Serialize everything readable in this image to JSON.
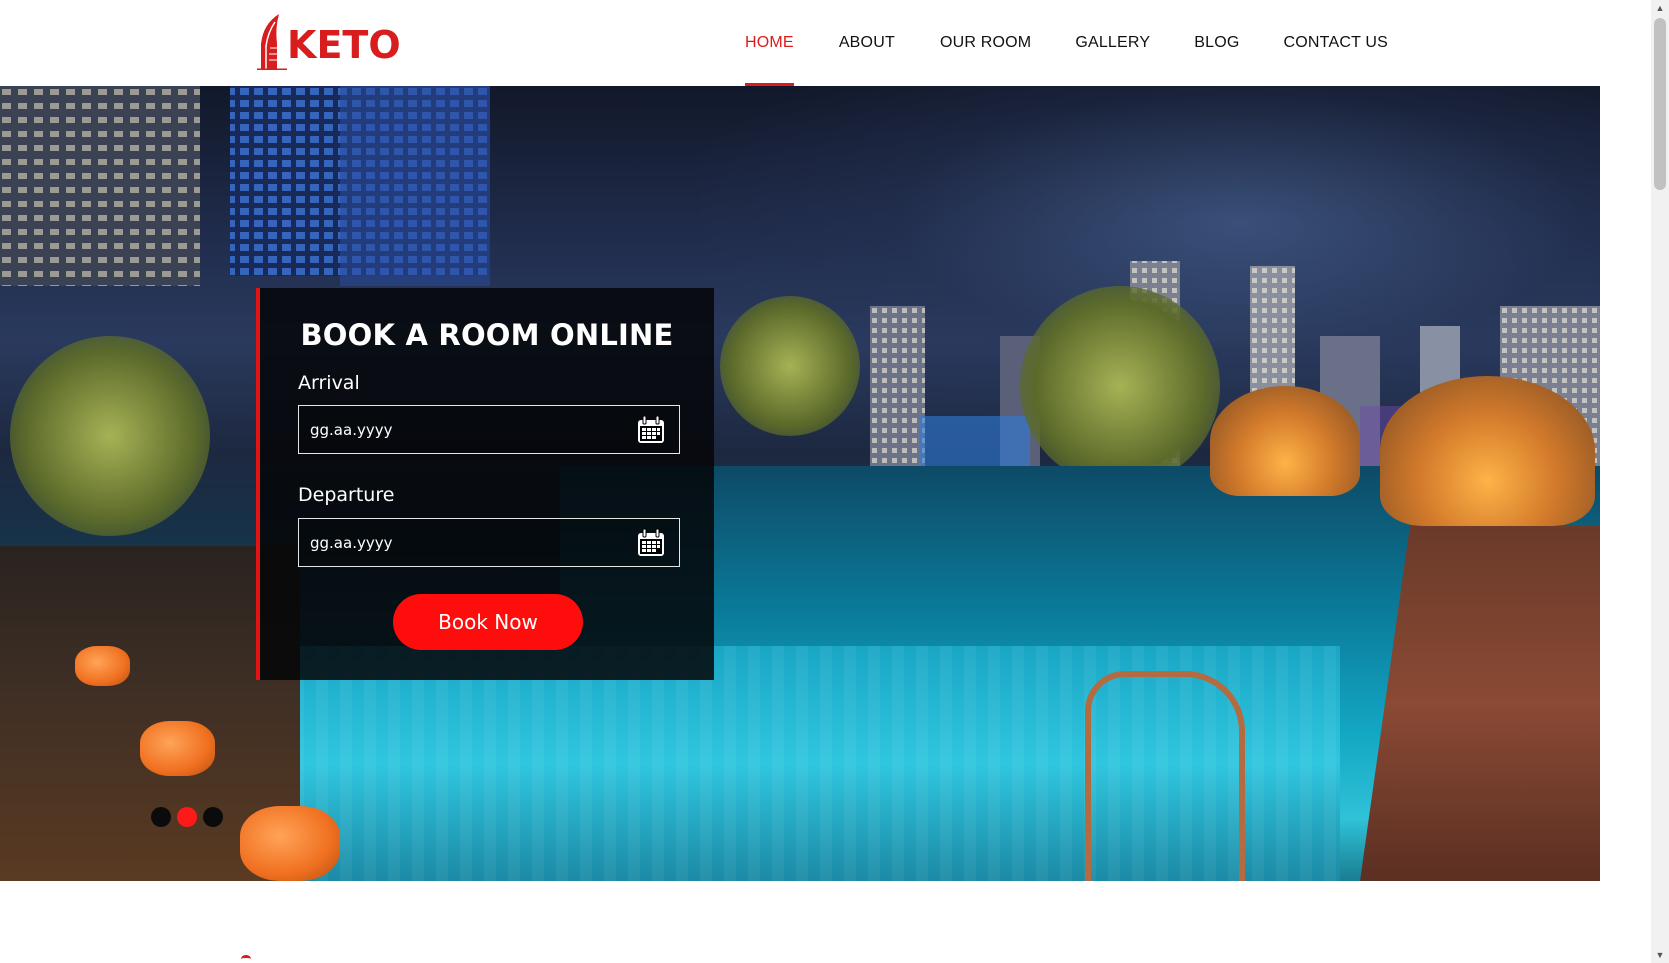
{
  "brand": {
    "name": "KETO",
    "logo_icon": "hotel-tower-icon",
    "color": "#d71d1d"
  },
  "nav": {
    "items": [
      {
        "label": "HOME",
        "active": true
      },
      {
        "label": "ABOUT",
        "active": false
      },
      {
        "label": "OUR ROOM",
        "active": false
      },
      {
        "label": "GALLERY",
        "active": false
      },
      {
        "label": "BLOG",
        "active": false
      },
      {
        "label": "CONTACT US",
        "active": false
      }
    ],
    "active_color": "#d91c1c"
  },
  "booking": {
    "title": "BOOK A ROOM ONLINE",
    "arrival": {
      "label": "Arrival",
      "placeholder": "gg.aa.yyyy",
      "icon": "calendar-icon"
    },
    "departure": {
      "label": "Departure",
      "placeholder": "gg.aa.yyyy",
      "icon": "calendar-icon"
    },
    "submit_label": "Book Now",
    "accent": "#ff0d0d"
  },
  "slider": {
    "slide_count": 3,
    "active_index": 1
  }
}
